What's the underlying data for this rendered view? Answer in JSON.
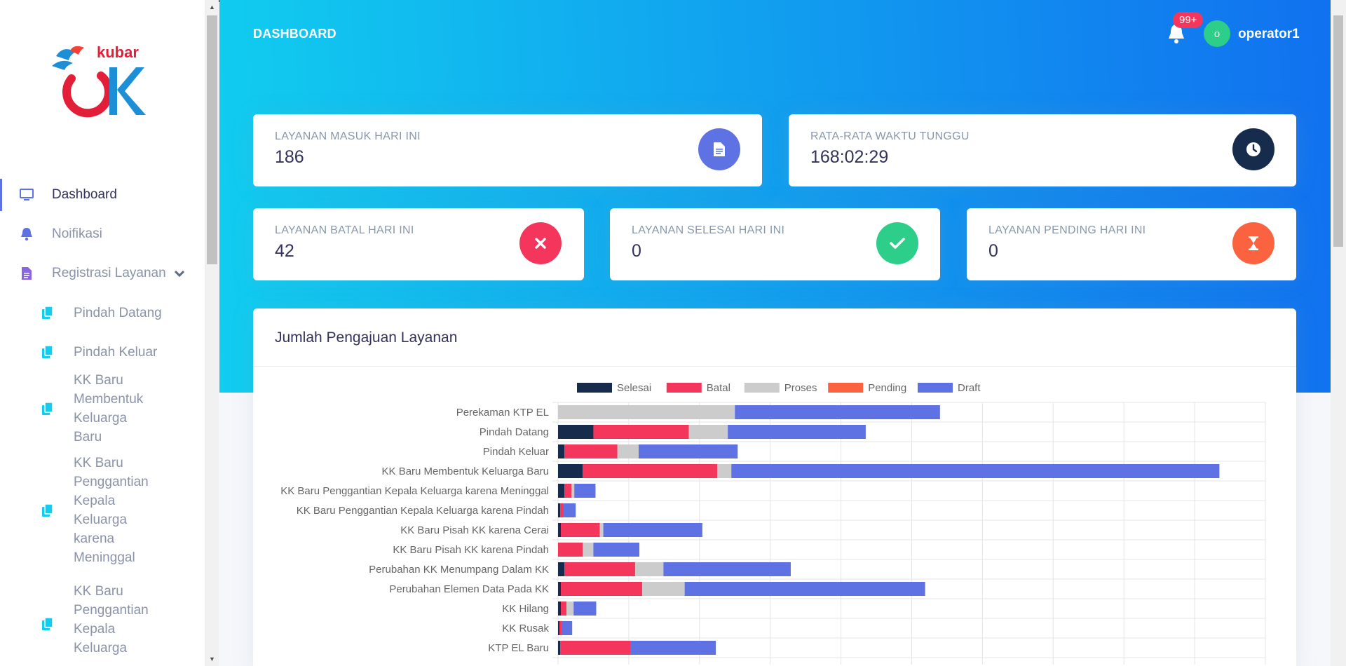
{
  "header": {
    "title": "DASHBOARD",
    "notification_badge": "99+",
    "user_initial": "o",
    "user_name": "operator1"
  },
  "sidebar": {
    "items": [
      {
        "label": "Dashboard",
        "icon": "monitor-icon",
        "active": true
      },
      {
        "label": "Noifikasi",
        "icon": "bell-icon"
      },
      {
        "label": "Registrasi Layanan",
        "icon": "document-icon",
        "expandable": true
      }
    ],
    "sub_items": [
      {
        "label": "Pindah Datang"
      },
      {
        "label": "Pindah Keluar"
      },
      {
        "label": "KK Baru Membentuk Keluarga Baru"
      },
      {
        "label": "KK Baru Penggantian Kepala Keluarga karena Meninggal"
      },
      {
        "label": "KK Baru Penggantian Kepala Keluarga"
      }
    ]
  },
  "stats": [
    {
      "label": "LAYANAN MASUK HARI INI",
      "value": "186",
      "icon": "document-icon",
      "color": "#5e72e4"
    },
    {
      "label": "RATA-RATA WAKTU TUNGGU",
      "value": "168:02:29",
      "icon": "clock-icon",
      "color": "#172b4d"
    },
    {
      "label": "LAYANAN BATAL HARI INI",
      "value": "42",
      "icon": "times-icon",
      "color": "#f5365c"
    },
    {
      "label": "LAYANAN SELESAI HARI INI",
      "value": "0",
      "icon": "check-icon",
      "color": "#2dce89"
    },
    {
      "label": "LAYANAN PENDING HARI INI",
      "value": "0",
      "icon": "hourglass-icon",
      "color": "#fb6340"
    }
  ],
  "chart_title": "Jumlah Pengajuan Layanan",
  "chart_data": {
    "type": "bar",
    "orientation": "horizontal",
    "stacked": true,
    "title": "Jumlah Pengajuan Layanan",
    "legend_position": "top",
    "grid": true,
    "categories": [
      "Perekaman KTP EL",
      "Pindah Datang",
      "Pindah Keluar",
      "KK Baru Membentuk Keluarga Baru",
      "KK Baru Penggantian Kepala Keluarga karena Meninggal",
      "KK Baru Penggantian Kepala Keluarga karena Pindah",
      "KK Baru Pisah KK karena Cerai",
      "KK Baru Pisah KK karena Pindah",
      "Perubahan KK Menumpang Dalam KK",
      "Perubahan Elemen Data Pada KK",
      "KK Hilang",
      "KK Rusak",
      "KTP EL Baru"
    ],
    "xlim": [
      0,
      1000
    ],
    "series": [
      {
        "name": "Selesai",
        "color": "#172b4d",
        "values": [
          0,
          50,
          9,
          35,
          9,
          3,
          4,
          0,
          9,
          4,
          4,
          2,
          3
        ]
      },
      {
        "name": "Batal",
        "color": "#f5365c",
        "values": [
          0,
          135,
          75,
          190,
          10,
          5,
          55,
          35,
          100,
          115,
          8,
          3,
          100
        ]
      },
      {
        "name": "Proses",
        "color": "#cccccc",
        "values": [
          250,
          55,
          30,
          20,
          4,
          0,
          5,
          15,
          40,
          60,
          10,
          0,
          0
        ]
      },
      {
        "name": "Pending",
        "color": "#fb6340",
        "values": [
          0,
          0,
          0,
          0,
          0,
          0,
          0,
          0,
          0,
          0,
          0,
          0,
          0
        ]
      },
      {
        "name": "Draft",
        "color": "#5e72e4",
        "values": [
          290,
          195,
          140,
          690,
          30,
          17,
          140,
          65,
          180,
          340,
          32,
          15,
          120
        ]
      }
    ]
  }
}
